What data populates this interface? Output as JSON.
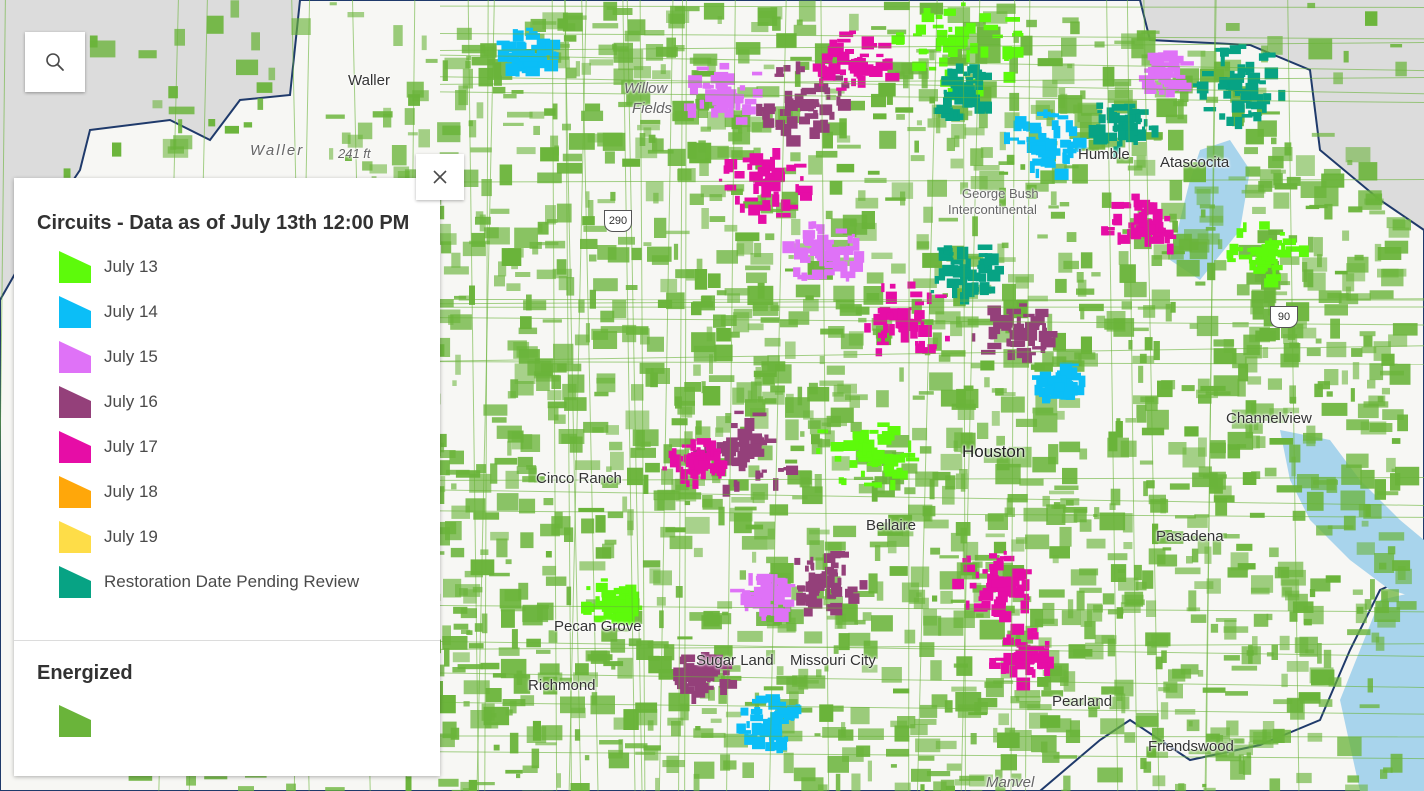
{
  "map": {
    "places": [
      {
        "name": "Waller",
        "key": "waller"
      },
      {
        "name": "Willow",
        "key": "willow"
      },
      {
        "name": "Fields",
        "key": "fields"
      },
      {
        "name": "Waller",
        "key": "waller-county"
      },
      {
        "name": "241 ft",
        "key": "elevation"
      },
      {
        "name": "Humble",
        "key": "humble"
      },
      {
        "name": "Atascocita",
        "key": "atascocita"
      },
      {
        "name": "George Bush",
        "key": "airport-1"
      },
      {
        "name": "Intercontinental",
        "key": "airport-2"
      },
      {
        "name": "Cinco Ranch",
        "key": "cinco-ranch"
      },
      {
        "name": "Houston",
        "key": "houston"
      },
      {
        "name": "Bellaire",
        "key": "bellaire"
      },
      {
        "name": "Pasadena",
        "key": "pasadena"
      },
      {
        "name": "Channelview",
        "key": "channelview"
      },
      {
        "name": "Pecan Grove",
        "key": "pecan-grove"
      },
      {
        "name": "Sugar Land",
        "key": "sugar-land"
      },
      {
        "name": "Missouri City",
        "key": "missouri-city"
      },
      {
        "name": "Richmond",
        "key": "richmond"
      },
      {
        "name": "Pearland",
        "key": "pearland"
      },
      {
        "name": "Friendswood",
        "key": "friendswood"
      },
      {
        "name": "Manvel",
        "key": "manvel"
      }
    ],
    "highway_shields": [
      {
        "label": "290",
        "key": "us-290"
      },
      {
        "label": "90",
        "key": "us-90"
      }
    ],
    "colors": {
      "energized": "#6ab43a",
      "water": "#a8d4ec",
      "boundary": "#1f3a6b",
      "background": "#f2f2ee"
    }
  },
  "search": {
    "icon": "search-icon"
  },
  "legend": {
    "close_icon": "close-icon",
    "circuits_title": "Circuits - Data as of July 13th 12:00 PM",
    "items": [
      {
        "label": "July 13",
        "color": "#5dfa0b"
      },
      {
        "label": "July 14",
        "color": "#0bbef7"
      },
      {
        "label": "July 15",
        "color": "#df72f7"
      },
      {
        "label": "July 16",
        "color": "#94407a"
      },
      {
        "label": "July 17",
        "color": "#e60da6"
      },
      {
        "label": "July 18",
        "color": "#ffa70a"
      },
      {
        "label": "July 19",
        "color": "#fedd48"
      },
      {
        "label": "Restoration Date Pending Review",
        "color": "#07a384"
      }
    ],
    "energized_title": "Energized",
    "energized_color": "#6ab43a"
  }
}
